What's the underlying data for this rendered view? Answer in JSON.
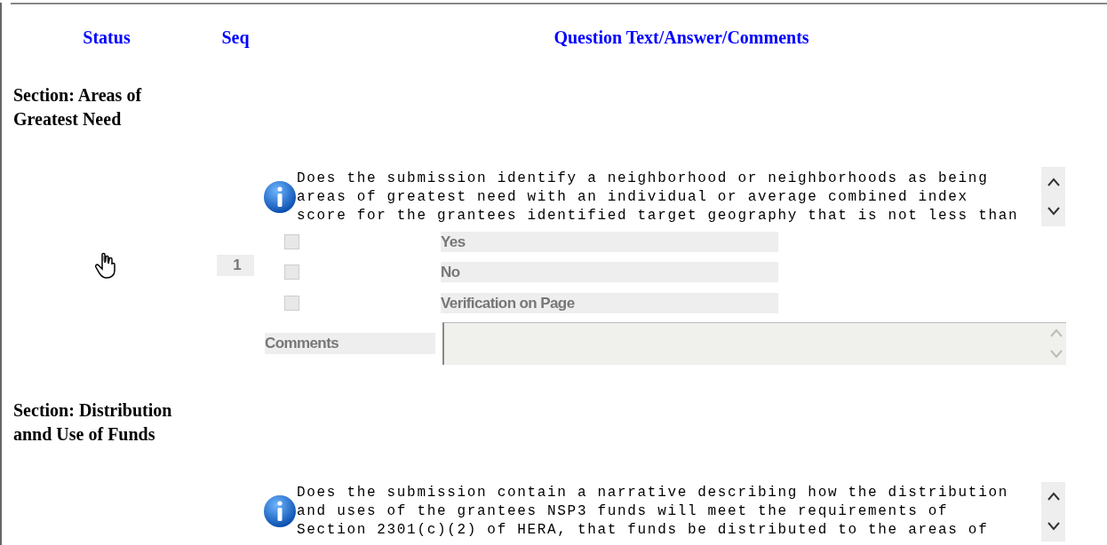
{
  "columns": [
    "Status",
    "Seq",
    "Question Text/Answer/Comments"
  ],
  "sections": [
    {
      "title": "Section: Areas of Greatest Need",
      "questions": [
        {
          "status_icon": true,
          "seq": "1",
          "text": "Does the submission identify a neighborhood or neighborhoods as being\nareas of greatest need with an individual or average combined index\nscore for the grantees identified target geography that is not less than",
          "options": [
            {
              "label": "Yes",
              "checked": false,
              "disabled": true
            },
            {
              "label": "No",
              "checked": false,
              "disabled": true
            },
            {
              "label": "Verification on Page",
              "checked": false,
              "disabled": true
            }
          ],
          "comments": {
            "label": "Comments",
            "disabled": true
          }
        }
      ]
    },
    {
      "title": "Section: Distribution annd Use of Funds",
      "questions": [
        {
          "text": "Does the submission contain a narrative describing how the distribution\nand uses of the grantees NSP3 funds will meet the requirements of\nSection 2301(c)(2) of HERA, that funds be distributed to the areas of"
        }
      ]
    }
  ]
}
